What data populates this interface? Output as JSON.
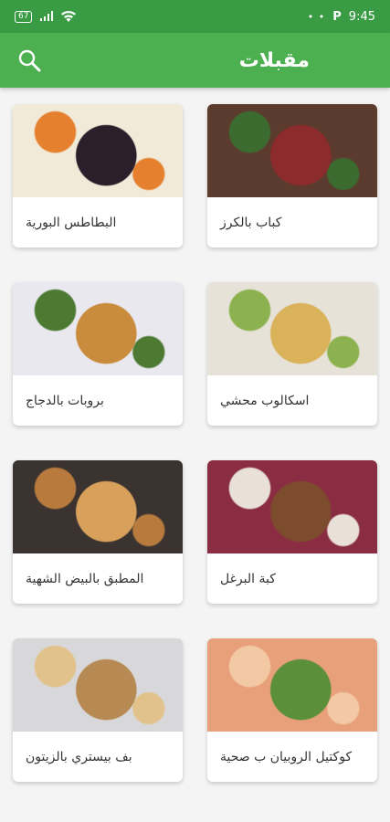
{
  "status": {
    "battery": "67",
    "time": "9:45",
    "carrier_icon": "P",
    "dots": "• •"
  },
  "app_bar": {
    "title": "مقبلات",
    "search_icon": "search-icon"
  },
  "recipes": [
    {
      "label": "كباب بالكرز",
      "colors": [
        "#5a3b2e",
        "#8b2b2b",
        "#3c6b2f"
      ]
    },
    {
      "label": "البطاطس البورية",
      "colors": [
        "#f1ead8",
        "#2a1f2b",
        "#e5802f"
      ]
    },
    {
      "label": "اسكالوب محشي",
      "colors": [
        "#e7e2d8",
        "#d9b25a",
        "#8bb24e"
      ]
    },
    {
      "label": "بروبات بالدجاج",
      "colors": [
        "#e8e8ee",
        "#c98b3c",
        "#4d7a33"
      ]
    },
    {
      "label": "كبة البرغل",
      "colors": [
        "#8a2d43",
        "#7d4b2e",
        "#e9e0d8"
      ]
    },
    {
      "label": "المطبق بالبيض الشهية",
      "colors": [
        "#3a3330",
        "#d8a05a",
        "#b87a3d"
      ]
    },
    {
      "label": "كوكتيل الروبيان ب صحية",
      "colors": [
        "#e8a07a",
        "#5c8f3a",
        "#f3c9a5"
      ]
    },
    {
      "label": "بف بيستري بالزيتون",
      "colors": [
        "#d8d8da",
        "#b68a52",
        "#e2c28b"
      ]
    }
  ]
}
